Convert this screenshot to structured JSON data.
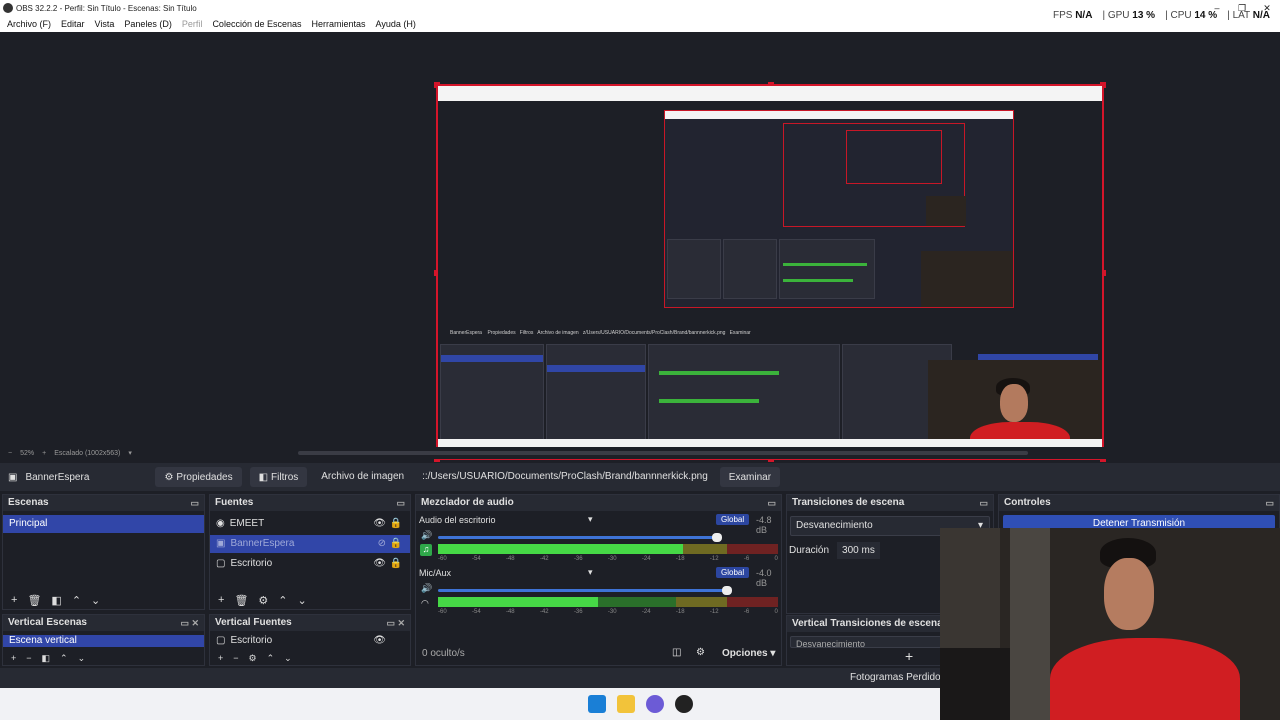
{
  "window": {
    "title": "OBS 32.2.2 - Perfil: Sin Título - Escenas: Sin Título"
  },
  "menu": [
    "Archivo (F)",
    "Editar",
    "Vista",
    "Paneles (D)",
    "Perfil",
    "Colección de Escenas",
    "Herramientas",
    "Ayuda (H)"
  ],
  "stats": {
    "fps_label": "FPS",
    "fps": "N/A",
    "gpu_label": "GPU",
    "gpu": "13 %",
    "cpu_label": "CPU",
    "cpu": "14 %",
    "lat_label": "LAT",
    "lat": "N/A"
  },
  "zoom": {
    "value": "52%",
    "scale": "Escalado (1002x563)"
  },
  "source_toolbar": {
    "name": "BannerEspera",
    "properties": "Propiedades",
    "filters": "Filtros",
    "image_label": "Archivo de imagen",
    "path": "::/Users/USUARIO/Documents/ProClash/Brand/bannnerkick.png",
    "browse": "Examinar"
  },
  "scenes": {
    "title": "Escenas",
    "items": [
      "Principal"
    ]
  },
  "sources": {
    "title": "Fuentes",
    "items": [
      "EMEET",
      "BannerEspera",
      "Escritorio"
    ]
  },
  "mixer": {
    "title": "Mezclador de audio",
    "channels": [
      {
        "name": "Audio del escritorio",
        "db": "-4.8 dB",
        "global": "Global",
        "level": 0.72
      },
      {
        "name": "Mic/Aux",
        "db": "-4.0 dB",
        "global": "Global",
        "level": 0.47
      }
    ],
    "ticks": [
      "-60",
      "-54",
      "-48",
      "-42",
      "-36",
      "-30",
      "-24",
      "-18",
      "-12",
      "-6",
      "0"
    ],
    "hidden": "0 oculto/s",
    "options": "Opciones"
  },
  "transitions": {
    "title": "Transiciones de escena",
    "selected": "Desvanecimiento",
    "duration_label": "Duración",
    "duration": "300 ms"
  },
  "controls": {
    "title": "Controles",
    "stop": "Detener Transmisión"
  },
  "vertical_scenes": {
    "title": "Vertical Escenas",
    "items": [
      "Escena vertical"
    ]
  },
  "vertical_sources": {
    "title": "Vertical Fuentes",
    "items": [
      "Escritorio"
    ]
  },
  "vertical_transitions": {
    "title": "Vertical Transiciones de escena",
    "selected": "Desvanecimiento"
  },
  "statusbar": {
    "frames": "Fotogramas Perdidos 0"
  },
  "colors": {
    "accent": "#3146a8",
    "outline": "#d4152a",
    "meter": "#46d846"
  }
}
